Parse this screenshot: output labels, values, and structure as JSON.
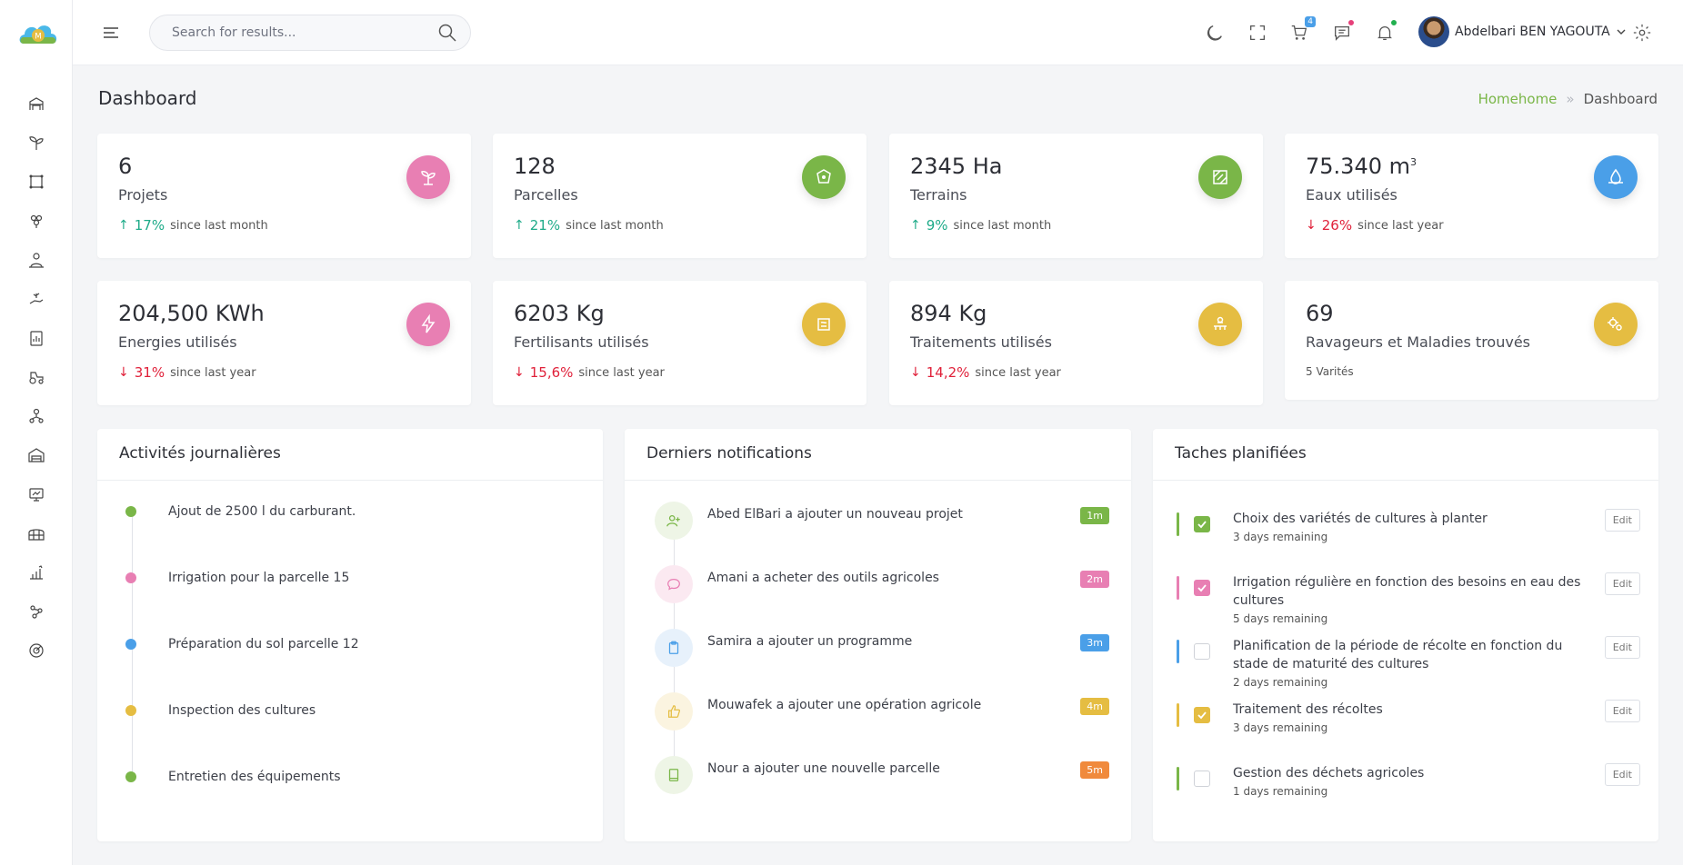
{
  "header": {
    "search_placeholder": "Search for results...",
    "cart_count": "4",
    "user_name": "Abdelbari BEN YAGOUTA"
  },
  "page": {
    "title": "Dashboard",
    "breadcrumb": {
      "home": "Homehome",
      "separator": "»",
      "current": "Dashboard"
    }
  },
  "stats": [
    {
      "value": "6",
      "label": "Projets",
      "direction": "up",
      "pct": "17%",
      "since": "since last month",
      "color": "#e87fb3",
      "icon": "plant-icon"
    },
    {
      "value": "128",
      "label": "Parcelles",
      "direction": "up",
      "pct": "21%",
      "since": "since last month",
      "color": "#7ab648",
      "icon": "parcel-icon"
    },
    {
      "value": "2345 Ha",
      "label": "Terrains",
      "direction": "up",
      "pct": "9%",
      "since": "since last month",
      "color": "#7ab648",
      "icon": "map-icon"
    },
    {
      "value": "75.340 m",
      "unit_sup": "3",
      "label": "Eaux utilisés",
      "direction": "down",
      "pct": "26%",
      "since": "since last year",
      "color": "#4a9fe8",
      "icon": "water-icon"
    },
    {
      "value": "204,500 KWh",
      "label": "Energies utilisés",
      "direction": "down",
      "pct": "31%",
      "since": "since last year",
      "color": "#e87fb3",
      "icon": "lightning-icon"
    },
    {
      "value": "6203 Kg",
      "label": "Fertilisants utilisés",
      "direction": "down",
      "pct": "15,6%",
      "since": "since last year",
      "color": "#e5bd42",
      "icon": "fertilizer-icon"
    },
    {
      "value": "894 Kg",
      "label": "Traitements utilisés",
      "direction": "down",
      "pct": "14,2%",
      "since": "since last year",
      "color": "#e5bd42",
      "icon": "treatment-icon"
    },
    {
      "value": "69",
      "label": "Ravageurs et Maladies trouvés",
      "sub": "5 Varités",
      "color": "#e5bd42",
      "icon": "bug-icon"
    }
  ],
  "activities": {
    "title": "Activités journalières",
    "items": [
      {
        "text": "Ajout de 2500 l du carburant.",
        "color": "#7ab648"
      },
      {
        "text": "Irrigation pour la parcelle 15",
        "color": "#e87fb3"
      },
      {
        "text": "Préparation du sol parcelle 12",
        "color": "#4a9fe8"
      },
      {
        "text": "Inspection des cultures",
        "color": "#e5bd42"
      },
      {
        "text": "Entretien des équipements",
        "color": "#7ab648"
      }
    ]
  },
  "notifications": {
    "title": "Derniers notifications",
    "items": [
      {
        "text": "Abed ElBari a ajouter un nouveau projet",
        "time": "1m",
        "color": "#7ab648",
        "bg": "#eef5e6",
        "icon": "user-plus-icon"
      },
      {
        "text": "Amani a acheter des outils agricoles",
        "time": "2m",
        "color": "#e87fb3",
        "bg": "#fbe9f1",
        "icon": "chat-icon"
      },
      {
        "text": "Samira a ajouter un programme",
        "time": "3m",
        "color": "#4a9fe8",
        "bg": "#e7f1fb",
        "icon": "clipboard-icon"
      },
      {
        "text": "Mouwafek a ajouter une opération agricole",
        "time": "4m",
        "color": "#e5bd42",
        "bg": "#fbf4e0",
        "icon": "thumbs-up-icon"
      },
      {
        "text": "Nour a ajouter une nouvelle parcelle",
        "time": "5m",
        "color": "#f08a3c",
        "bg": "#eef5e6",
        "icon": "book-icon"
      }
    ]
  },
  "tasks": {
    "title": "Taches planifiées",
    "edit_label": "Edit",
    "items": [
      {
        "title": "Choix des variétés de cultures à planter",
        "due": "3 days remaining",
        "checked": true,
        "color": "#7ab648"
      },
      {
        "title": "Irrigation régulière en fonction des besoins en eau des cultures",
        "due": "5 days remaining",
        "checked": true,
        "color": "#e87fb3"
      },
      {
        "title": "Planification de la période de récolte en fonction du stade de maturité des cultures",
        "due": "2 days remaining",
        "checked": false,
        "color": "#4a9fe8"
      },
      {
        "title": "Traitement des récoltes",
        "due": "3 days remaining",
        "checked": true,
        "color": "#e5bd42"
      },
      {
        "title": "Gestion des déchets agricoles",
        "due": "1 days remaining",
        "checked": false,
        "color": "#7ab648"
      }
    ]
  }
}
